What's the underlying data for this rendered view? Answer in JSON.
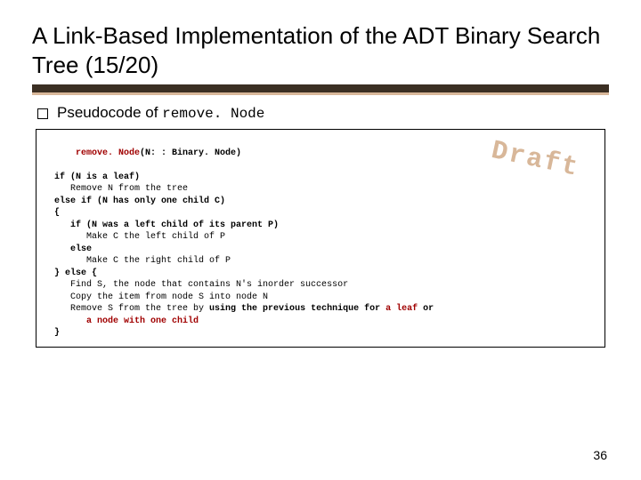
{
  "title": "A Link-Based Implementation of the ADT Binary Search Tree (15/20)",
  "bullet": {
    "prefix": "Pseudocode of ",
    "code": "remove. Node"
  },
  "pseudocode": {
    "sig_fn": "remove. Node",
    "sig_args": "(N: : Binary. Node)",
    "l1": "if (N is a leaf)",
    "l2": "Remove N from the tree",
    "l3": "else if (N has only one child C)",
    "l4": "{",
    "l5": "if (N was a left child of its parent P)",
    "l6": "Make C the left child of P",
    "l7": "else",
    "l8": "Make C the right child of P",
    "l9": "} else {",
    "l10": "Find S, the node that contains N's inorder successor",
    "l11": "Copy the item from node S into node N",
    "l12_a": "Remove S from the tree by ",
    "l12_b": "using the previous technique for",
    "l12_c": " a leaf ",
    "l12_d": "or",
    "l13": "a node with one child",
    "l14": "}"
  },
  "watermark": "Draft",
  "pagenum": "36"
}
